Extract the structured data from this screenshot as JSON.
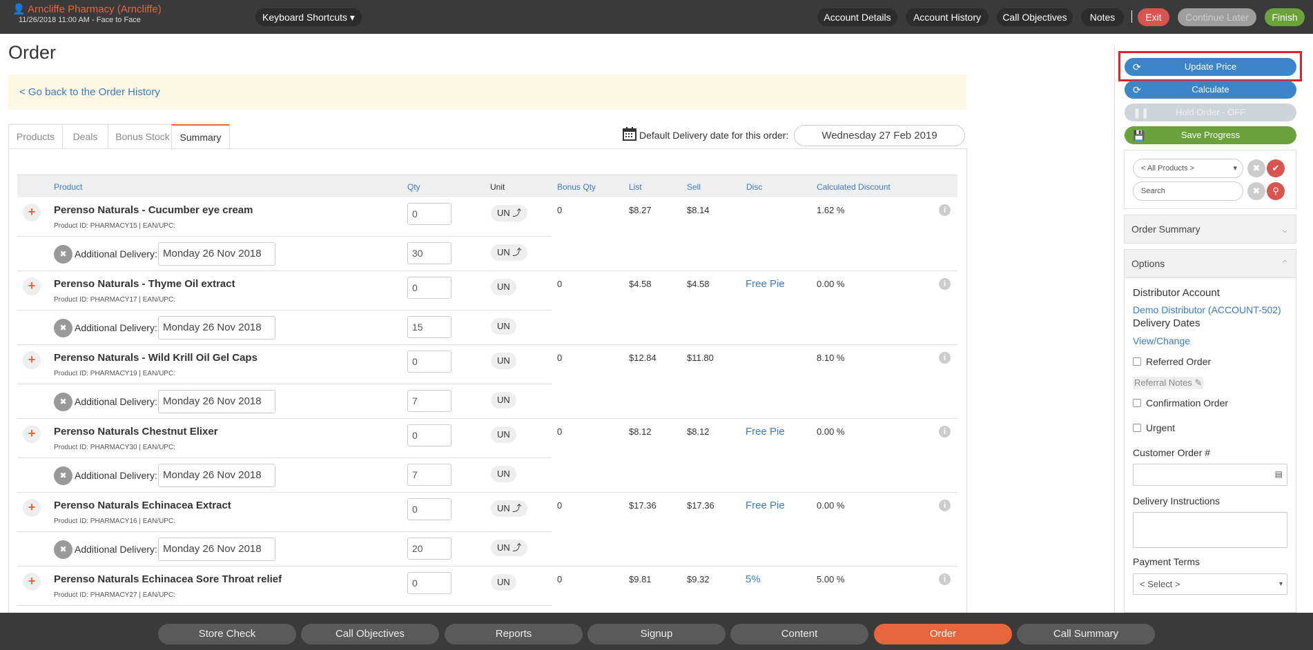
{
  "header": {
    "account_name": "Arncliffe Pharmacy (Arncliffe)",
    "visit_info": "11/26/2018 11:00 AM - Face to Face",
    "keyboard_shortcuts": "Keyboard Shortcuts",
    "buttons": {
      "account_details": "Account Details",
      "account_history": "Account History",
      "call_objectives": "Call Objectives",
      "notes": "Notes",
      "exit": "Exit",
      "continue_later": "Continue Later",
      "finish": "Finish"
    }
  },
  "page": {
    "title": "Order",
    "back_link": "< Go back to the Order History"
  },
  "tabs": [
    "Products",
    "Deals",
    "Bonus Stock",
    "Summary"
  ],
  "delivery": {
    "label": "Default Delivery date for this order:",
    "date": "Wednesday 27 Feb 2019"
  },
  "table": {
    "headers": {
      "product": "Product",
      "qty": "Qty",
      "unit": "Unit",
      "bonus_qty": "Bonus Qty",
      "list": "List",
      "sell": "Sell",
      "disc": "Disc",
      "calc_discount": "Calculated Discount"
    },
    "additional_label": "Additional Delivery:",
    "rows": [
      {
        "name": "Perenso Naturals - Cucumber eye cream",
        "pid": "Product ID: PHARMACY15 | EAN/UPC:",
        "qty": "0",
        "unit": "UN ⤴",
        "bonus": "0",
        "list": "$8.27",
        "sell": "$8.14",
        "disc": "",
        "calc": "1.62 %",
        "add_date": "Monday 26 Nov 2018",
        "add_qty": "30",
        "add_unit": "UN ⤴"
      },
      {
        "name": "Perenso Naturals - Thyme Oil extract",
        "pid": "Product ID: PHARMACY17 | EAN/UPC:",
        "qty": "0",
        "unit": "UN",
        "bonus": "0",
        "list": "$4.58",
        "sell": "$4.58",
        "disc": "Free Pie",
        "calc": "0.00 %",
        "add_date": "Monday 26 Nov 2018",
        "add_qty": "15",
        "add_unit": "UN"
      },
      {
        "name": "Perenso Naturals - Wild Krill Oil Gel Caps",
        "pid": "Product ID: PHARMACY19 | EAN/UPC:",
        "qty": "0",
        "unit": "UN",
        "bonus": "0",
        "list": "$12.84",
        "sell": "$11.80",
        "disc": "",
        "calc": "8.10 %",
        "add_date": "Monday 26 Nov 2018",
        "add_qty": "7",
        "add_unit": "UN"
      },
      {
        "name": "Perenso Naturals Chestnut Elixer",
        "pid": "Product ID: PHARMACY30 | EAN/UPC:",
        "qty": "0",
        "unit": "UN",
        "bonus": "0",
        "list": "$8.12",
        "sell": "$8.12",
        "disc": "Free Pie",
        "calc": "0.00 %",
        "add_date": "Monday 26 Nov 2018",
        "add_qty": "7",
        "add_unit": "UN"
      },
      {
        "name": "Perenso Naturals Echinacea Extract",
        "pid": "Product ID: PHARMACY16 | EAN/UPC:",
        "qty": "0",
        "unit": "UN ⤴",
        "bonus": "0",
        "list": "$17.36",
        "sell": "$17.36",
        "disc": "Free Pie",
        "calc": "0.00 %",
        "add_date": "Monday 26 Nov 2018",
        "add_qty": "20",
        "add_unit": "UN ⤴"
      },
      {
        "name": "Perenso Naturals Echinacea Sore Throat relief",
        "pid": "Product ID: PHARMACY27 | EAN/UPC:",
        "qty": "0",
        "unit": "UN",
        "bonus": "0",
        "list": "$9.81",
        "sell": "$9.32",
        "disc": "5%",
        "calc": "5.00 %"
      }
    ]
  },
  "sidebar": {
    "update_price": "Update Price",
    "calculate": "Calculate",
    "hold_order": "Hold Order - OFF",
    "save_progress": "Save Progress",
    "product_filter": "< All Products >",
    "search_placeholder": "Search",
    "order_summary": "Order Summary",
    "options": "Options",
    "distributor_account_label": "Distributor Account",
    "distributor_account_value": "Demo Distributor (ACCOUNT-502)",
    "delivery_dates_label": "Delivery Dates",
    "view_change": "View/Change",
    "referred_order": "Referred Order",
    "referral_notes": "Referral Notes",
    "confirmation_order": "Confirmation Order",
    "urgent": "Urgent",
    "customer_order_label": "Customer Order #",
    "delivery_instructions_label": "Delivery Instructions",
    "payment_terms_label": "Payment Terms",
    "payment_terms_value": "< Select >"
  },
  "bottom_nav": [
    "Store Check",
    "Call Objectives",
    "Reports",
    "Signup",
    "Content",
    "Order",
    "Call Summary"
  ],
  "colors": {
    "accent": "#e8643a",
    "link": "#3a7bbf",
    "primary_btn": "#3a86c8",
    "save_btn": "#6aa23c",
    "exit_btn": "#d9534f"
  }
}
